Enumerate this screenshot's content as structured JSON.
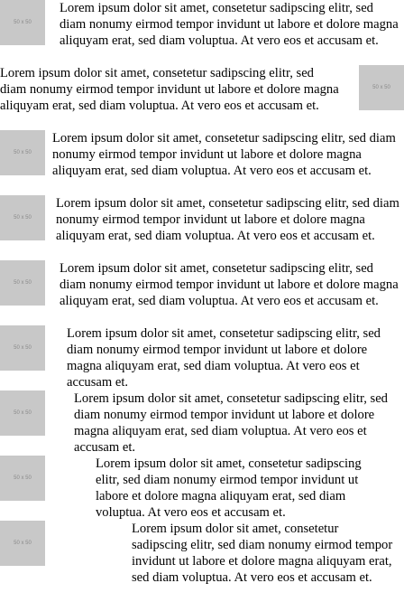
{
  "placeholder_label": "50 x 50",
  "paragraph_text": "Lorem ipsum dolor sit amet, consetetur sadipscing elitr, sed diam nonumy eirmod tempor invidunt ut labore et dolore magna aliquyam erat, sed diam voluptua. At vero eos et accusam et.",
  "colors": {
    "placeholder_fill": "#c8c8c8",
    "placeholder_text": "#8a8a8a",
    "text": "#000000"
  }
}
